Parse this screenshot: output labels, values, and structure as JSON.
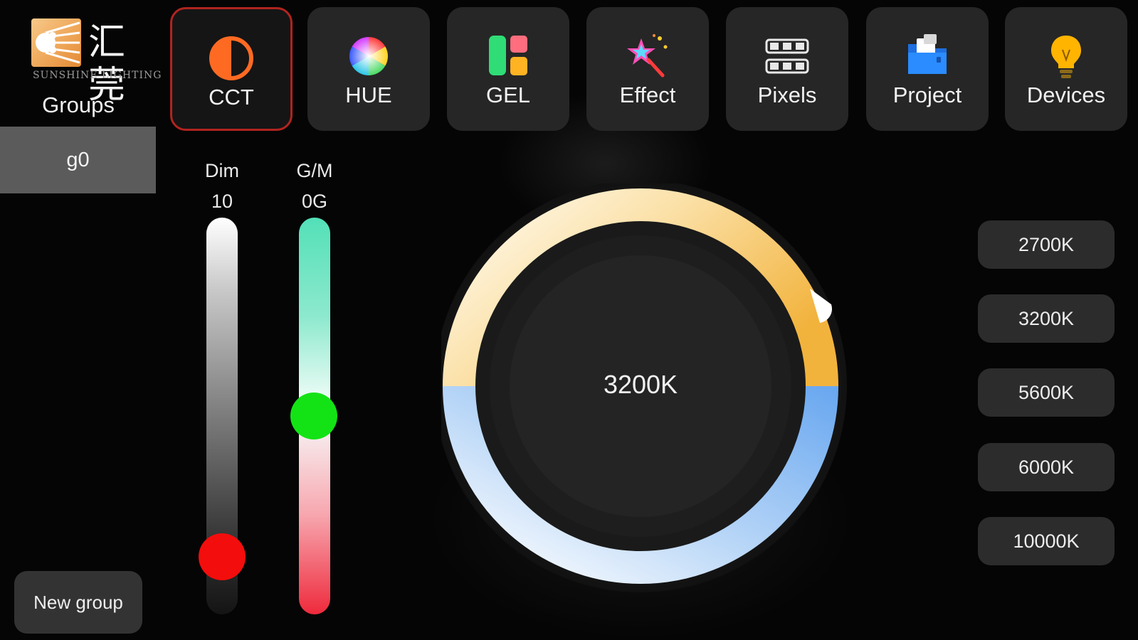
{
  "logo": {
    "cn_text": "汇莞",
    "en_text": "SUNSHINE LIGHTING",
    "color": "#eea455"
  },
  "groups": {
    "title": "Groups",
    "items": [
      {
        "label": "g0",
        "selected": true
      }
    ],
    "new_group_label": "New group"
  },
  "tabs": [
    {
      "label": "CCT",
      "icon": "half-circle-icon",
      "active": true
    },
    {
      "label": "HUE",
      "icon": "color-wheel-icon",
      "active": false
    },
    {
      "label": "GEL",
      "icon": "gel-swatch-icon",
      "active": false
    },
    {
      "label": "Effect",
      "icon": "magic-star-icon",
      "active": false
    },
    {
      "label": "Pixels",
      "icon": "pixel-grid-icon",
      "active": false
    },
    {
      "label": "Project",
      "icon": "folder-icon",
      "active": false
    },
    {
      "label": "Devices",
      "icon": "lightbulb-icon",
      "active": false
    }
  ],
  "sliders": {
    "dim": {
      "label": "Dim",
      "value_text": "10",
      "value": 10,
      "range": [
        0,
        100
      ]
    },
    "gm": {
      "label": "G/M",
      "value_text": "0G",
      "value": 0,
      "range": [
        -100,
        100
      ]
    }
  },
  "dial": {
    "value_text": "3200K",
    "value": 3200,
    "warm_color": "#f2b33d",
    "cool_color": "#6aa8f0"
  },
  "presets": [
    "2700K",
    "3200K",
    "5600K",
    "6000K",
    "10000K"
  ],
  "colors": {
    "active_border": "#b0241f",
    "dim_knob": "#f40d0d",
    "gm_knob": "#13e315"
  }
}
